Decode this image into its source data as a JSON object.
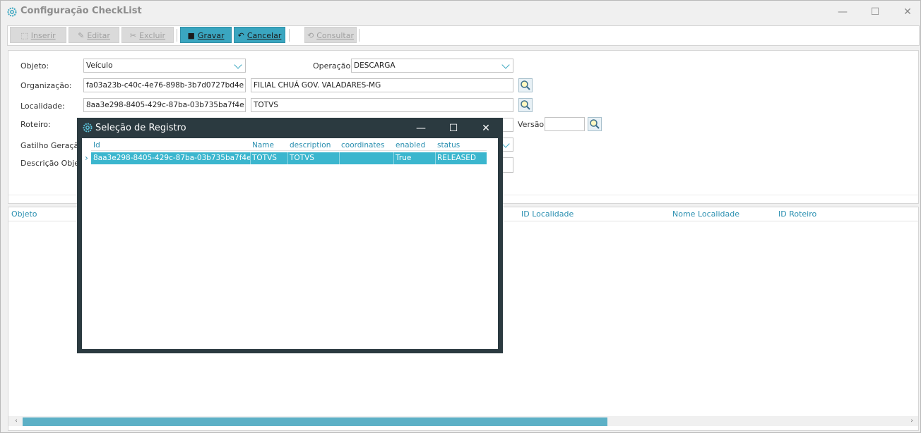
{
  "window": {
    "title": "Configuração CheckList",
    "controls": {
      "minimize": "—",
      "maximize": "☐",
      "close": "✕"
    }
  },
  "toolbar": {
    "inserir": "Inserir",
    "editar": "Editar",
    "excluir": "Excluir",
    "gravar": "Gravar",
    "cancelar": "Cancelar",
    "consultar": "Consultar"
  },
  "form": {
    "objeto_label": "Objeto:",
    "objeto_value": "Veículo",
    "operacao_label": "Operação:",
    "operacao_value": "DESCARGA",
    "organizacao_label": "Organização:",
    "organizacao_id": "fa03a23b-c40c-4e76-898b-3b7d0727bd4e",
    "organizacao_nome": "FILIAL CHUÁ GOV. VALADARES-MG",
    "localidade_label": "Localidade:",
    "localidade_id": "8aa3e298-8405-429c-87ba-03b735ba7f4e",
    "localidade_nome": "TOTVS",
    "roteiro_label": "Roteiro:",
    "versao_label": "Versão",
    "versao_value": "",
    "gatilho_label": "Gatilho Geração:",
    "descricao_label": "Descrição Objeto"
  },
  "grid": {
    "columns": [
      "Objeto",
      "ID Localidade",
      "Nome Localidade",
      "ID Roteiro"
    ],
    "scroll_left": "‹",
    "scroll_right": "›"
  },
  "dialog": {
    "title": "Seleção de Registro",
    "controls": {
      "minimize": "—",
      "maximize": "☐",
      "close": "✕"
    },
    "columns": [
      "Id",
      "Name",
      "description",
      "coordinates",
      "enabled",
      "status"
    ],
    "rows": [
      {
        "id": "8aa3e298-8405-429c-87ba-03b735ba7f4e",
        "name": "TOTVS",
        "description": "TOTVS",
        "coordinates": "",
        "enabled": "True",
        "status": "RELEASED"
      }
    ],
    "row_indicator": "›"
  },
  "colors": {
    "accent": "#3bb6ce",
    "dialog_bg": "#2b3a40",
    "header_text": "#2a8fb0"
  }
}
